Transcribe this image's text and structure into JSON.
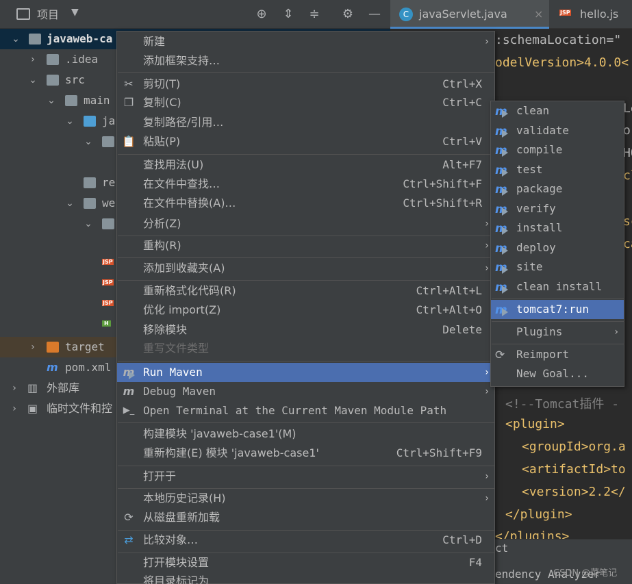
{
  "project_panel": {
    "title": "项目",
    "tree": [
      {
        "label": "javaweb-ca",
        "expanded": true
      },
      {
        "label": ".idea",
        "expanded": false
      },
      {
        "label": "src",
        "expanded": true
      },
      {
        "label": "main",
        "expanded": true
      },
      {
        "label": "ja",
        "expanded": true
      },
      {
        "label": "",
        "expanded": true
      },
      {
        "label": "re",
        "expanded": false
      },
      {
        "label": "we",
        "expanded": true
      },
      {
        "label": "",
        "expanded": true
      },
      {
        "label": "target",
        "expanded": false
      },
      {
        "label": "pom.xml",
        "expanded": false
      },
      {
        "label": "外部库",
        "expanded": false
      },
      {
        "label": "临时文件和控",
        "expanded": false
      }
    ],
    "file_badges": [
      "JSP",
      "JSP",
      "JSP",
      "H"
    ]
  },
  "tabs": [
    {
      "label": "javaServlet.java",
      "close": "×"
    },
    {
      "label": "hello.js"
    }
  ],
  "editor": {
    "lines": [
      ":schemaLocation=\"",
      "odelVersion>4.0.0<",
      "Le",
      "o-",
      "HO",
      "cl",
      "sc",
      "ca",
      "<!--Tomcat插件 -",
      "<plugin>",
      "<groupId>org.a",
      "<artifactId>to",
      "<version>2.2</",
      "</plugin>",
      "</plugins>"
    ]
  },
  "bottom": {
    "line1": "ct",
    "line2": "endency Analyzer"
  },
  "context_menu": {
    "items": [
      {
        "label": "新建",
        "submenu": true
      },
      {
        "label": "添加框架支持…"
      },
      {
        "label": "剪切(T)",
        "shortcut": "Ctrl+X",
        "icon": "scissors-icon"
      },
      {
        "label": "复制(C)",
        "shortcut": "Ctrl+C",
        "icon": "copy-icon"
      },
      {
        "label": "复制路径/引用…"
      },
      {
        "label": "粘贴(P)",
        "shortcut": "Ctrl+V",
        "icon": "paste-icon"
      },
      {
        "label": "查找用法(U)",
        "shortcut": "Alt+F7"
      },
      {
        "label": "在文件中查找…",
        "shortcut": "Ctrl+Shift+F"
      },
      {
        "label": "在文件中替换(A)…",
        "shortcut": "Ctrl+Shift+R"
      },
      {
        "label": "分析(Z)",
        "submenu": true
      },
      {
        "label": "重构(R)",
        "submenu": true
      },
      {
        "label": "添加到收藏夹(A)",
        "submenu": true
      },
      {
        "label": "重新格式化代码(R)",
        "shortcut": "Ctrl+Alt+L"
      },
      {
        "label": "优化 import(Z)",
        "shortcut": "Ctrl+Alt+O"
      },
      {
        "label": "移除模块",
        "shortcut": "Delete"
      },
      {
        "label": "重写文件类型",
        "disabled": true
      },
      {
        "label": "Run Maven",
        "submenu": true,
        "active": true,
        "icon": "maven-run-icon"
      },
      {
        "label": "Debug Maven",
        "submenu": true,
        "icon": "maven-debug-icon"
      },
      {
        "label": "Open Terminal at the Current Maven Module Path",
        "icon": "terminal-icon"
      },
      {
        "label": "构建模块 'javaweb-case1'(M)"
      },
      {
        "label": "重新构建(E) 模块 'javaweb-case1'",
        "shortcut": "Ctrl+Shift+F9"
      },
      {
        "label": "打开于",
        "submenu": true
      },
      {
        "label": "本地历史记录(H)",
        "submenu": true
      },
      {
        "label": "从磁盘重新加载",
        "icon": "reload-icon"
      },
      {
        "label": "比较对象…",
        "shortcut": "Ctrl+D",
        "icon": "compare-icon"
      },
      {
        "label": "打开模块设置",
        "shortcut": "F4"
      },
      {
        "label": "将目录标记为"
      }
    ]
  },
  "run_maven_submenu": {
    "items": [
      {
        "label": "clean"
      },
      {
        "label": "validate"
      },
      {
        "label": "compile"
      },
      {
        "label": "test"
      },
      {
        "label": "package"
      },
      {
        "label": "verify"
      },
      {
        "label": "install"
      },
      {
        "label": "deploy"
      },
      {
        "label": "site"
      },
      {
        "label": "clean install"
      },
      {
        "label": "tomcat7:run",
        "active": true
      },
      {
        "label": "Plugins",
        "submenu": true
      },
      {
        "label": "Reimport",
        "icon": "reimport-icon"
      },
      {
        "label": "New Goal..."
      }
    ]
  },
  "watermark": "CSDN @菜笔记",
  "colors": {
    "accent": "#4b6eaf",
    "panel": "#3c3f41",
    "editor": "#2b2b2b",
    "xml_tag": "#e8bf6a",
    "xml_text": "#a9b7c6",
    "comment": "#808080",
    "keyword": "#cc7832"
  }
}
